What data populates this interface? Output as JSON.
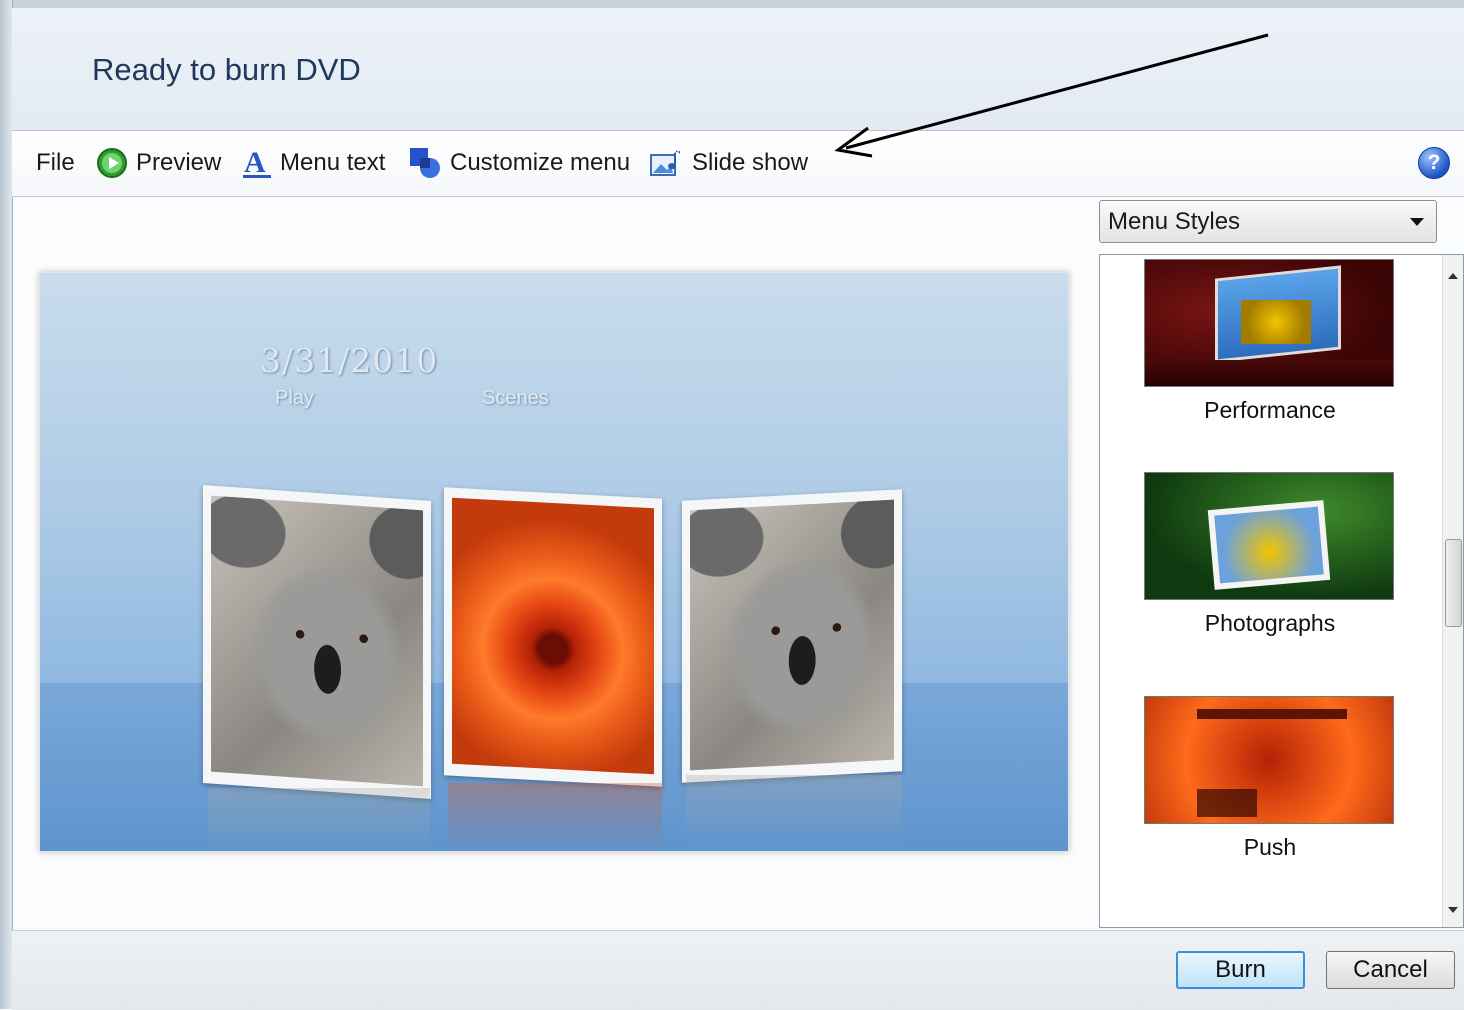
{
  "window": {
    "title": "Ready to burn DVD"
  },
  "toolbar": {
    "file": "File",
    "preview": "Preview",
    "menu_text": "Menu text",
    "customize_menu": "Customize menu",
    "slide_show": "Slide show",
    "help_glyph": "?"
  },
  "preview": {
    "title_text": "3/31/2010",
    "play_label": "Play",
    "scenes_label": "Scenes"
  },
  "styles": {
    "dropdown_value": "Menu Styles",
    "items": [
      {
        "label": "Performance"
      },
      {
        "label": "Photographs"
      },
      {
        "label": "Push"
      }
    ]
  },
  "buttons": {
    "burn": "Burn",
    "cancel": "Cancel"
  },
  "colors": {
    "title": "#1e395b",
    "accent": "#3c8fd6",
    "annotation_arrow": "#000000"
  },
  "icons": [
    "preview-play-icon",
    "menu-text-icon",
    "customize-menu-icon",
    "slide-show-icon",
    "help-icon"
  ]
}
